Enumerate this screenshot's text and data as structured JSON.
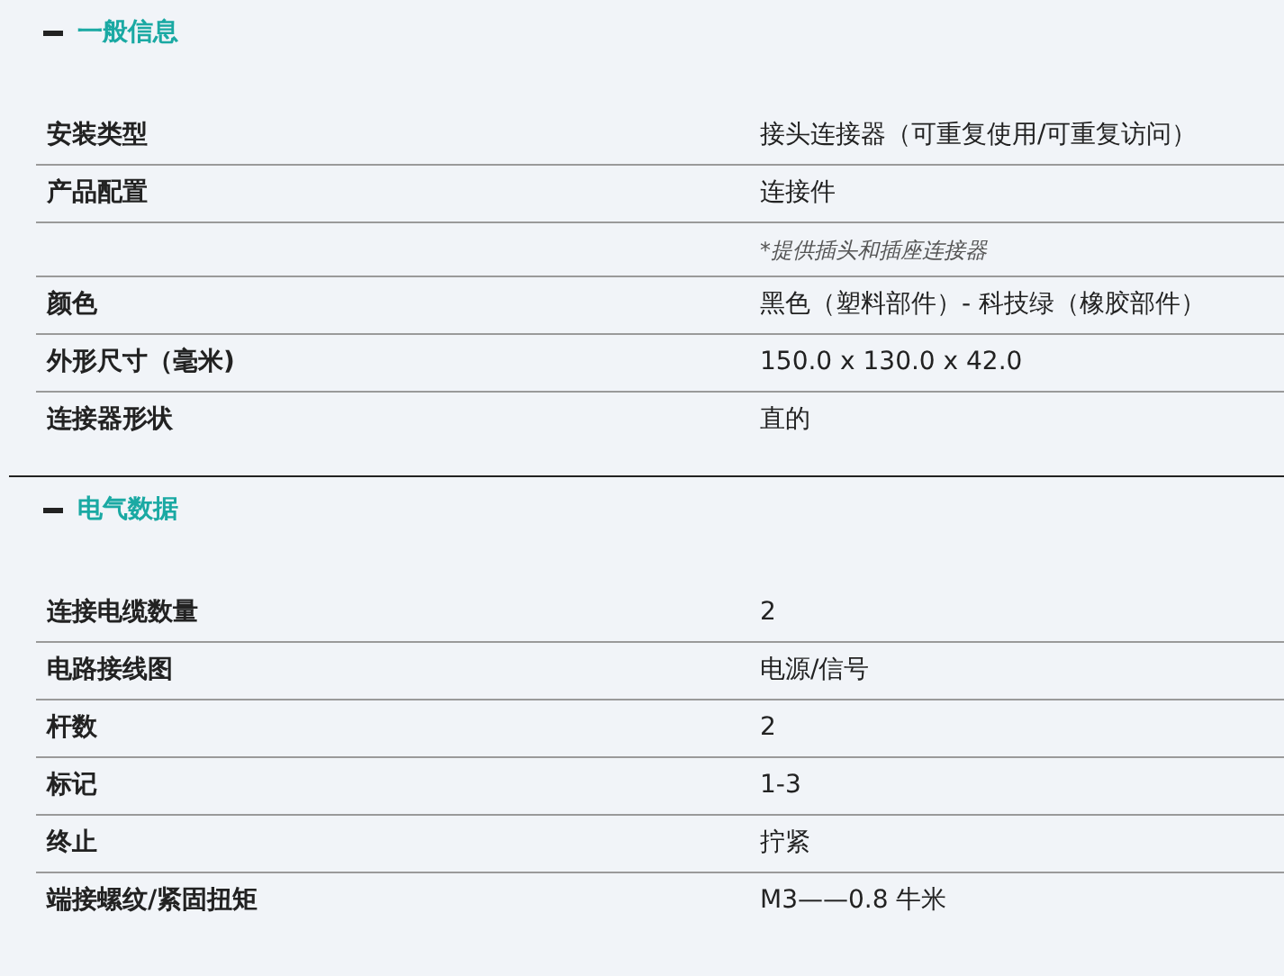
{
  "sections": [
    {
      "title": "一般信息",
      "expanded": true,
      "rows": [
        {
          "kind": "spec",
          "label": "安装类型",
          "value": "接头连接器（可重复使用/可重复访问）"
        },
        {
          "kind": "spec",
          "label": "产品配置",
          "value": "连接件"
        },
        {
          "kind": "note",
          "value": "*提供插头和插座连接器"
        },
        {
          "kind": "spec",
          "label": "颜色",
          "value": "黑色（塑料部件）- 科技绿（橡胶部件）"
        },
        {
          "kind": "spec",
          "label": "外形尺寸（毫米)",
          "value": "150.0 x 130.0 x 42.0"
        },
        {
          "kind": "spec",
          "label": "连接器形状",
          "value": "直的"
        }
      ]
    },
    {
      "title": "电气数据",
      "expanded": true,
      "rows": [
        {
          "kind": "spec",
          "label": "连接电缆数量",
          "value": "2"
        },
        {
          "kind": "spec",
          "label": "电路接线图",
          "value": "电源/信号"
        },
        {
          "kind": "spec",
          "label": "杆数",
          "value": "2"
        },
        {
          "kind": "spec",
          "label": "标记",
          "value": "1-3"
        },
        {
          "kind": "spec",
          "label": "终止",
          "value": "拧紧"
        },
        {
          "kind": "spec",
          "label": "端接螺纹/紧固扭矩",
          "value": "M3——0.8 牛米"
        }
      ]
    }
  ]
}
